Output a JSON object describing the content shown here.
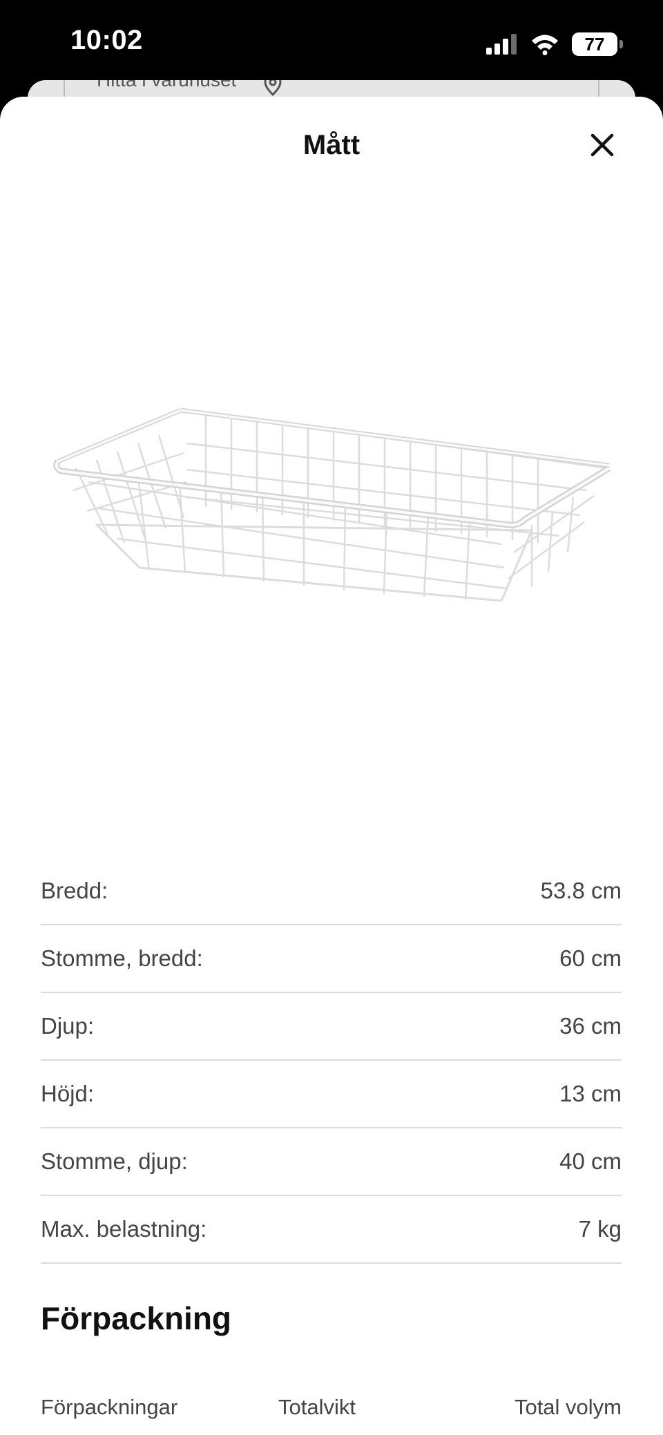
{
  "status_bar": {
    "time": "10:02",
    "battery": "77",
    "icons": [
      "cellular-signal-icon",
      "wifi-icon",
      "battery-icon"
    ]
  },
  "background_sheet": {
    "text": "Hitta i varuhuset",
    "icon": "location-pin-icon"
  },
  "sheet": {
    "title": "Mått",
    "close_icon": "close-icon"
  },
  "product_image": {
    "icon": "wire-basket-image"
  },
  "dimensions": [
    {
      "label": "Bredd:",
      "value": "53.8 cm"
    },
    {
      "label": "Stomme, bredd:",
      "value": "60 cm"
    },
    {
      "label": "Djup:",
      "value": "36 cm"
    },
    {
      "label": "Höjd:",
      "value": "13 cm"
    },
    {
      "label": "Stomme, djup:",
      "value": "40 cm"
    },
    {
      "label": "Max. belastning:",
      "value": "7 kg"
    }
  ],
  "packaging": {
    "title": "Förpackning",
    "columns": [
      "Förpackningar",
      "Totalvikt",
      "Total volym"
    ]
  }
}
